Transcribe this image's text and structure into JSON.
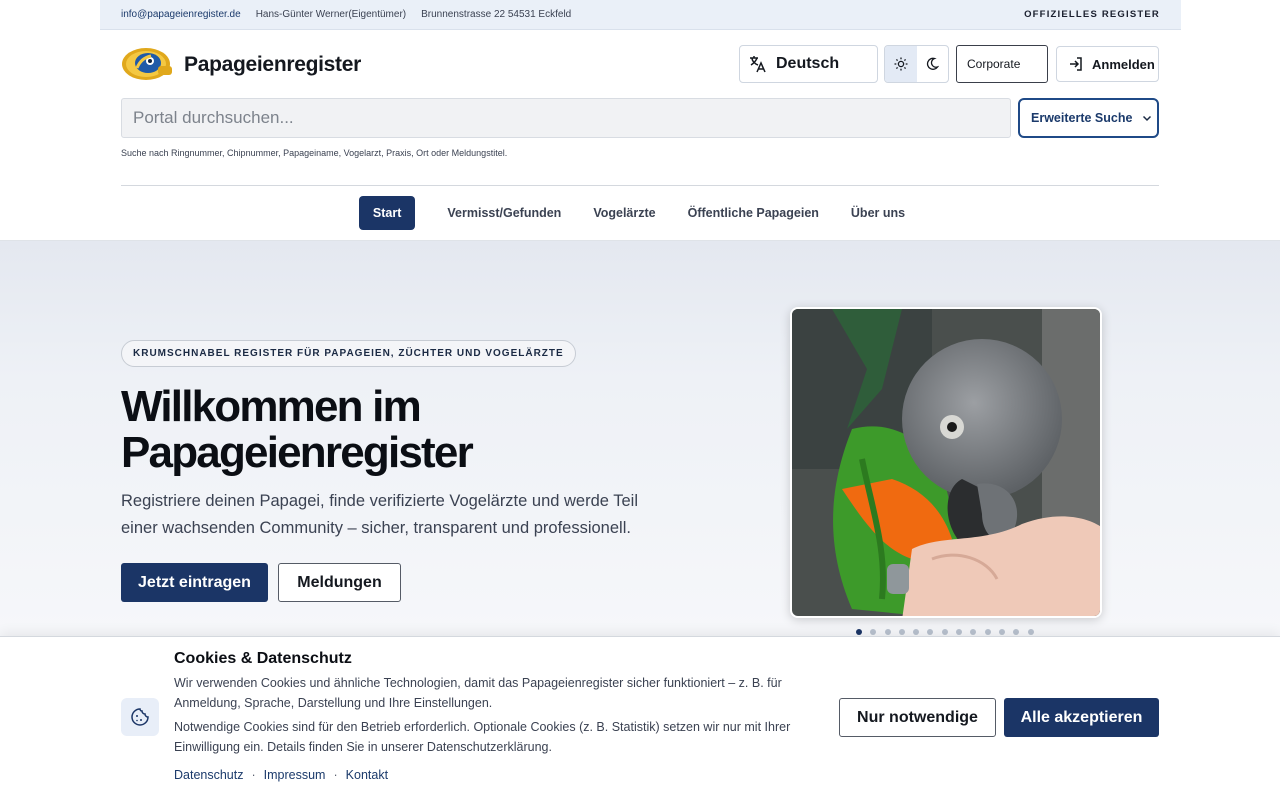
{
  "topbar": {
    "email": "info@papageienregister.de",
    "owner": "Hans-Günter Werner(Eigentümer)",
    "address": "Brunnenstrasse 22 54531 Eckfeld",
    "official_label": "OFFIZIELLES REGISTER"
  },
  "header": {
    "brand": "Papageienregister",
    "language_label": "Deutsch",
    "theme_options": [
      "light-icon",
      "dark-icon"
    ],
    "corporate_label": "Corporate",
    "login_label": "Anmelden"
  },
  "search": {
    "placeholder": "Portal durchsuchen...",
    "advanced_label": "Erweiterte Suche",
    "hint": "Suche nach Ringnummer, Chipnummer, Papageiname, Vogelarzt, Praxis, Ort oder Meldungstitel."
  },
  "nav": {
    "items": [
      {
        "label": "Start"
      },
      {
        "label": "Vermisst/Gefunden"
      },
      {
        "label": "Vogelärzte"
      },
      {
        "label": "Öffentliche Papageien"
      },
      {
        "label": "Über uns"
      }
    ],
    "active_index": 0
  },
  "hero": {
    "kicker": "KRUMSCHNABEL REGISTER FÜR PAPAGEIEN, ZÜCHTER UND VOGELÄRZTE",
    "title": "Willkommen im Papageienregister",
    "subtitle": "Registriere deinen Papagei, finde verifizierte Vogelärzte und werde Teil einer wachsenden Community – sicher, transparent und professionell.",
    "primary_button": "Jetzt eintragen",
    "secondary_button": "Meldungen",
    "carousel": {
      "slides": 13,
      "active": 0
    }
  },
  "cookie": {
    "title": "Cookies & Datenschutz",
    "text1": "Wir verwenden Cookies und ähnliche Technologien, damit das Papageienregister sicher funktioniert – z. B. für Anmeldung, Sprache, Darstellung und Ihre Einstellungen.",
    "text2": "Notwendige Cookies sind für den Betrieb erforderlich. Optionale Cookies (z. B. Statistik) setzen wir nur mit Ihrer Einwilligung ein. Details finden Sie in unserer Datenschutzerklärung.",
    "links": [
      "Datenschutz",
      "Impressum",
      "Kontakt"
    ],
    "btn_necessary": "Nur notwendige",
    "btn_accept_all": "Alle akzeptieren"
  },
  "colors": {
    "primary": "#1b3566",
    "accent_border": "#1f4a87",
    "topbar_bg": "#eaf0f8"
  }
}
